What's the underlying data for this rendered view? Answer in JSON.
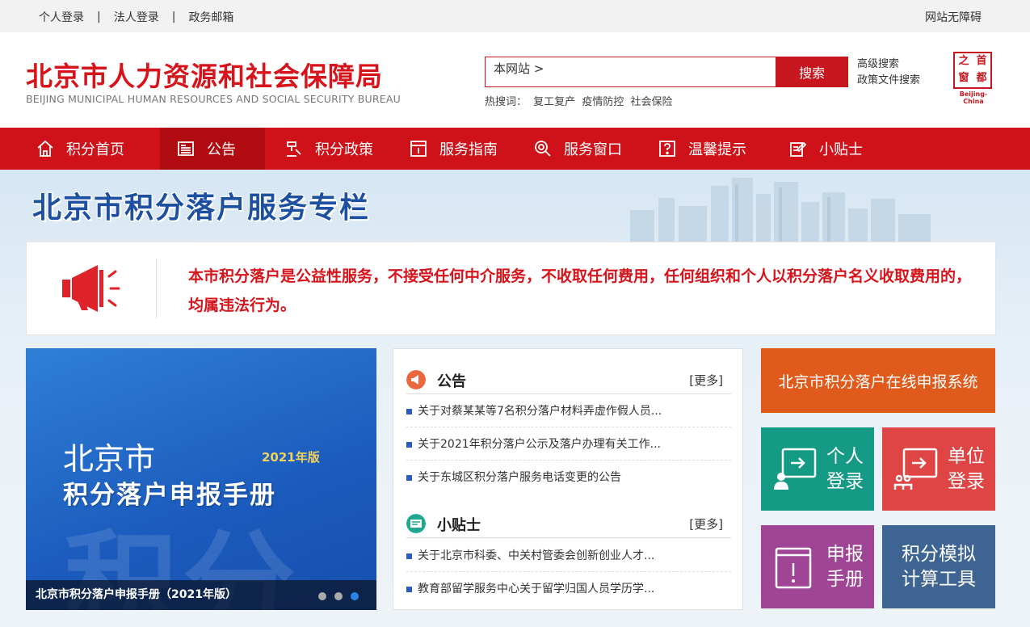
{
  "topbar": {
    "links": [
      "个人登录",
      "法人登录",
      "政务邮箱"
    ],
    "separator": "|",
    "accessibility": "网站无障碍"
  },
  "header": {
    "logo_cn": "北京市人力资源和社会保障局",
    "logo_en": "BEIJING MUNICIPAL HUMAN RESOURCES AND SOCIAL SECURITY BUREAU",
    "search_scope": "本网站 >",
    "search_button": "搜索",
    "hot_label": "热搜词：",
    "hot_words": [
      "复工复产",
      "疫情防控",
      "社会保险"
    ],
    "advanced_search": "高级搜索",
    "policy_search": "政策文件搜索",
    "seal_chars": [
      "之",
      "首",
      "窗",
      "都"
    ],
    "seal_en": "Beijing-China"
  },
  "nav": {
    "items": [
      {
        "label": "积分首页",
        "icon": "home-icon"
      },
      {
        "label": "公告",
        "icon": "news-icon",
        "active": true
      },
      {
        "label": "积分政策",
        "icon": "gavel-icon"
      },
      {
        "label": "服务指南",
        "icon": "book-icon"
      },
      {
        "label": "服务窗口",
        "icon": "magnifier-icon"
      },
      {
        "label": "温馨提示",
        "icon": "question-icon"
      },
      {
        "label": "小贴士",
        "icon": "edit-icon"
      }
    ]
  },
  "banner": {
    "title": "北京市积分落户服务专栏"
  },
  "notice": {
    "text": "本市积分落户是公益性服务，不接受任何中介服务，不收取任何费用，任何组织和个人以积分落户名义收取费用的，均属违法行为。"
  },
  "carousel": {
    "line1": "北京市",
    "year": "2021年版",
    "line2": "积分落户申报手册",
    "watermark": "积分",
    "caption": "北京市积分落户申报手册（2021年版）"
  },
  "announcements": {
    "title": "公告",
    "more": "[更多]",
    "items": [
      "关于对蔡某某等7名积分落户材料弄虚作假人员...",
      "关于2021年积分落户公示及落户办理有关工作...",
      "关于东城区积分落户服务电话变更的公告"
    ]
  },
  "tips": {
    "title": "小贴士",
    "more": "[更多]",
    "items": [
      "关于北京市科委、中关村管委会创新创业人才...",
      "教育部留学服务中心关于留学归国人员学历学..."
    ]
  },
  "tiles": {
    "online": "北京市积分落户在线申报系统",
    "personal": [
      "个人",
      "登录"
    ],
    "unit": [
      "单位",
      "登录"
    ],
    "handbook": [
      "申报",
      "手册"
    ],
    "calculator": [
      "积分模拟",
      "计算工具"
    ]
  },
  "colors": {
    "brand_red": "#cf1119",
    "nav_active": "#b10b12",
    "banner_blue": "#1e50a2",
    "online_orange": "#df5a1b",
    "personal_teal": "#149a85",
    "unit_red": "#e04545",
    "handbook_purple": "#a04596",
    "calculator_blue": "#3e6493"
  }
}
